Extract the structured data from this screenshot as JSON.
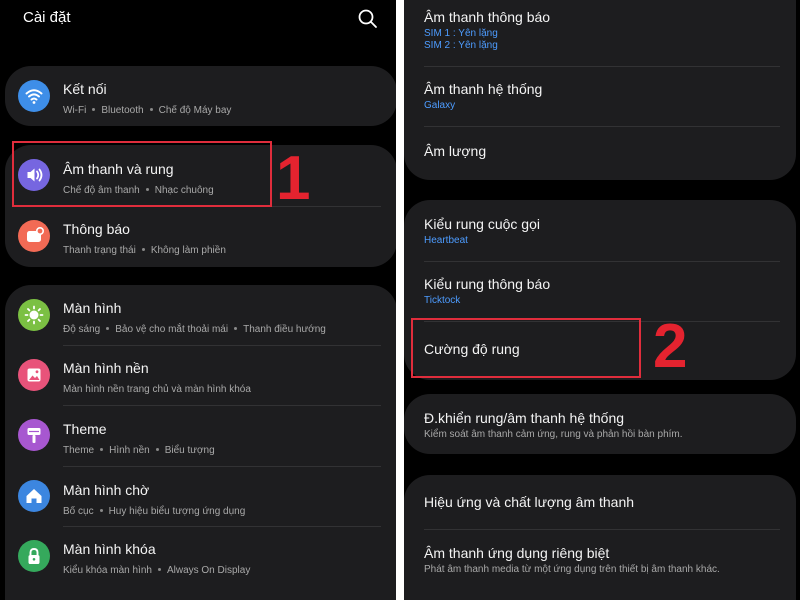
{
  "left_panel": {
    "title": "Cài đặt",
    "search_icon": "search-icon",
    "rows": [
      {
        "title": "Kết nối",
        "sub": [
          "Wi-Fi",
          "Bluetooth",
          "Chế độ Máy bay"
        ],
        "icon": "wifi-icon",
        "icon_color": "#3e8ee8"
      },
      {
        "title": "Âm thanh và rung",
        "sub": [
          "Chế độ âm thanh",
          "Nhạc chuông"
        ],
        "icon": "volume-icon",
        "icon_color": "#7666e0"
      },
      {
        "title": "Thông báo",
        "sub": [
          "Thanh trạng thái",
          "Không làm phiền"
        ],
        "icon": "notification-icon",
        "icon_color": "#f26a55"
      },
      {
        "title": "Màn hình",
        "sub": [
          "Độ sáng",
          "Bảo vệ cho mắt thoải mái",
          "Thanh điều hướng"
        ],
        "icon": "brightness-icon",
        "icon_color": "#7bc043"
      },
      {
        "title": "Màn hình nền",
        "sub": [
          "Màn hình nền trang chủ và màn hình khóa"
        ],
        "icon": "wallpaper-icon",
        "icon_color": "#e8537a"
      },
      {
        "title": "Theme",
        "sub": [
          "Theme",
          "Hình nền",
          "Biểu tượng"
        ],
        "icon": "theme-icon",
        "icon_color": "#a757d0"
      },
      {
        "title": "Màn hình chờ",
        "sub": [
          "Bố cục",
          "Huy hiệu biểu tượng ứng dụng"
        ],
        "icon": "home-icon",
        "icon_color": "#3c86e0"
      },
      {
        "title": "Màn hình khóa",
        "sub": [
          "Kiểu khóa màn hình",
          "Always On Display"
        ],
        "icon": "lock-icon",
        "icon_color": "#35a95c"
      }
    ],
    "callout": "1"
  },
  "right_panel": {
    "rows": [
      {
        "title": "Âm thanh thông báo",
        "sub_lines": [
          "SIM 1 : Yên lặng",
          "SIM 2 : Yên lặng"
        ]
      },
      {
        "title": "Âm thanh hệ thống",
        "sub_lines": [
          "Galaxy"
        ]
      },
      {
        "title": "Âm lượng",
        "sub_lines": []
      },
      {
        "title": "Kiểu rung cuộc gọi",
        "sub_lines": [
          "Heartbeat"
        ]
      },
      {
        "title": "Kiểu rung thông báo",
        "sub_lines": [
          "Ticktock"
        ]
      },
      {
        "title": "Cường độ rung",
        "sub_lines": []
      },
      {
        "title": "Đ.khiển rung/âm thanh hệ thống",
        "sub_lines": [
          "Kiểm soát âm thanh cảm ứng, rung và phản hồi bàn phím."
        ]
      },
      {
        "title": "Hiệu ứng và chất lượng âm thanh",
        "sub_lines": []
      },
      {
        "title": "Âm thanh ứng dụng riêng biệt",
        "sub_lines": [
          "Phát âm thanh media từ một ứng dụng trên thiết bị âm thanh khác."
        ]
      }
    ],
    "callout": "2"
  },
  "colors": {
    "highlight": "#e02d3c",
    "link_blue": "#4d9cff"
  }
}
